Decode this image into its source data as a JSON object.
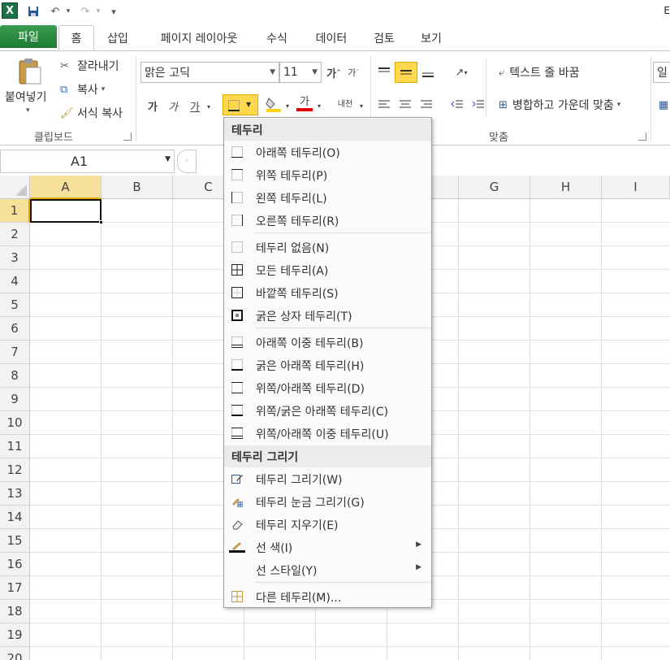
{
  "qat": {
    "app_icon": "X",
    "save_icon": "save-icon",
    "undo": "↶",
    "redo": "↷",
    "customize": "▾"
  },
  "title": "E",
  "tabs": [
    "파일",
    "홈",
    "삽입",
    "페이지 레이아웃",
    "수식",
    "데이터",
    "검토",
    "보기"
  ],
  "clipboard": {
    "paste": "붙여넣기",
    "cut": "잘라내기",
    "copy": "복사",
    "format_painter": "서식 복사",
    "group_label": "클립보드"
  },
  "font": {
    "name": "맑은 고딕",
    "size": "11",
    "grow": "가",
    "shrink": "가",
    "bold": "가",
    "italic": "가",
    "underline": "가",
    "font_color": "가",
    "phonetic": "내천"
  },
  "alignment": {
    "wrap_text": "텍스트 줄 바꿈",
    "merge_center": "병합하고 가운데 맞춤",
    "group_label": "맞춤"
  },
  "next_group_peek": "일",
  "name_box": "A1",
  "columns": [
    "A",
    "B",
    "C",
    "D",
    "E",
    "F",
    "G",
    "H",
    "I"
  ],
  "rows": [
    "1",
    "2",
    "3",
    "4",
    "5",
    "6",
    "7",
    "8",
    "9",
    "10",
    "11",
    "12",
    "13",
    "14",
    "15",
    "16",
    "17",
    "18",
    "19",
    "20"
  ],
  "menu": {
    "header1": "테두리",
    "items1": [
      {
        "label": "아래쪽 테두리(O)"
      },
      {
        "label": "위쪽 테두리(P)"
      },
      {
        "label": "왼쪽 테두리(L)"
      },
      {
        "label": "오른쪽 테두리(R)"
      }
    ],
    "items2": [
      {
        "label": "테두리 없음(N)"
      },
      {
        "label": "모든 테두리(A)"
      },
      {
        "label": "바깥쪽 테두리(S)"
      },
      {
        "label": "굵은 상자 테두리(T)"
      }
    ],
    "items3": [
      {
        "label": "아래쪽 이중 테두리(B)"
      },
      {
        "label": "굵은 아래쪽 테두리(H)"
      },
      {
        "label": "위쪽/아래쪽 테두리(D)"
      },
      {
        "label": "위쪽/굵은 아래쪽 테두리(C)"
      },
      {
        "label": "위쪽/아래쪽 이중 테두리(U)"
      }
    ],
    "header2": "테두리 그리기",
    "items4": [
      {
        "label": "테두리 그리기(W)"
      },
      {
        "label": "테두리 눈금 그리기(G)"
      },
      {
        "label": "테두리 지우기(E)"
      },
      {
        "label": "선 색(I)"
      },
      {
        "label": "선 스타일(Y)"
      }
    ],
    "more": "다른 테두리(M)..."
  },
  "colors": {
    "file_tab": "#2e8b45",
    "highlight": "#ffd84d",
    "font_red": "#e00000",
    "excel_green": "#1e7145"
  }
}
